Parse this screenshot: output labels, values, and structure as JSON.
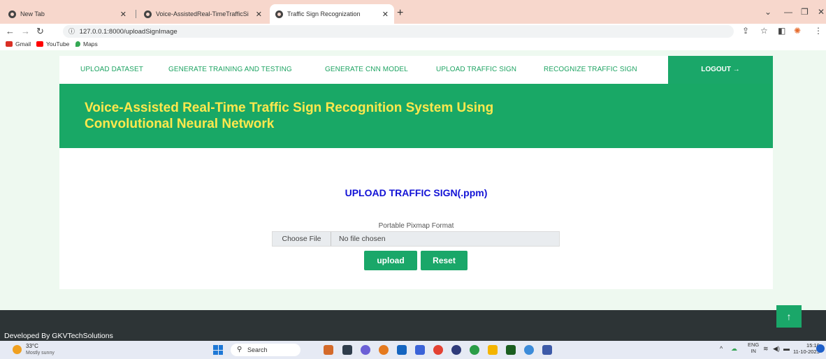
{
  "browser": {
    "tabs": [
      {
        "label": "New Tab"
      },
      {
        "label": "Voice-AssistedReal-TimeTrafficSi"
      },
      {
        "label": "Traffic Sign Recognization"
      }
    ],
    "new_tab": "+",
    "url": "127.0.0.1:8000/uploadSignImage",
    "bookmarks": [
      "Gmail",
      "YouTube",
      "Maps"
    ]
  },
  "nav": {
    "items": [
      "UPLOAD DATASET",
      "GENERATE TRAINING AND TESTING",
      "GENERATE CNN MODEL",
      "UPLOAD TRAFFIC SIGN",
      "RECOGNIZE TRAFFIC SIGN"
    ],
    "logout": "LOGOUT →"
  },
  "banner": {
    "line1": "Voice-Assisted Real-Time Traffic Sign Recognition System Using",
    "line2": "Convolutional Neural Network"
  },
  "upload": {
    "title": "UPLOAD TRAFFIC SIGN(.ppm)",
    "format_label": "Portable Pixmap Format",
    "choose_file": "Choose File",
    "no_file": "No file chosen",
    "upload_btn": "upload",
    "reset_btn": "Reset"
  },
  "footer": {
    "text": "Developed By GKVTechSolutions",
    "to_top": "↑"
  },
  "taskbar": {
    "temp": "33°C",
    "condition": "Mostly sunny",
    "search": "Search",
    "lang": "ENG",
    "lang_sub": "IN",
    "time": "15:10",
    "date": "11-10-2023"
  }
}
